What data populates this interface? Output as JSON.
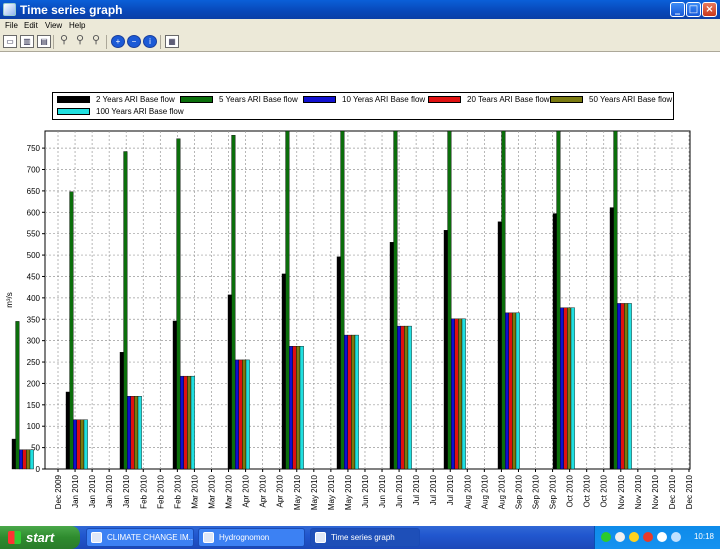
{
  "window": {
    "title": "Time series graph"
  },
  "menu": [
    "File",
    "Edit",
    "View",
    "Help"
  ],
  "toolbar": {
    "buttons": [
      "chart-area-icon",
      "chart-bar-icon",
      "chart-table-icon",
      "zoom-icon",
      "zoom-in-icon",
      "zoom-out-icon",
      "pan-left-icon",
      "pan-right-icon",
      "info-icon",
      "grid-icon"
    ]
  },
  "colors": {
    "s2": "#000000",
    "s5": "#0b6e0b",
    "s10": "#1010d0",
    "s20": "#e01010",
    "s50": "#7a7a10",
    "s100": "#20e0e0",
    "titlebar": "#0a4fc8",
    "taskbar": "#245edb"
  },
  "chart_data": {
    "type": "bar",
    "title": "",
    "xlabel": "",
    "ylabel": "m³/s",
    "ylim": [
      0,
      790
    ],
    "yticks": [
      0,
      50,
      100,
      150,
      200,
      250,
      300,
      350,
      400,
      450,
      500,
      550,
      600,
      650,
      700,
      750
    ],
    "grid": true,
    "legend_position": "top",
    "series": [
      {
        "name": "2 Years ARI Base flow",
        "color": "#000000"
      },
      {
        "name": "5 Years ARI Base flow",
        "color": "#0b6e0b"
      },
      {
        "name": "10 Yeras ARI Base flow",
        "color": "#1010d0"
      },
      {
        "name": "20 Tears ARI Base flow",
        "color": "#e01010"
      },
      {
        "name": "50 Years ARI Base flow",
        "color": "#7a7a10"
      },
      {
        "name": "100 Years ARI Base flow",
        "color": "#20e0e0"
      }
    ],
    "x_tick_labels": [
      "Dec 2009",
      "Jan 2010",
      "Jan 2010",
      "Jan 2010",
      "Jan 2010",
      "Feb 2010",
      "Feb 2010",
      "Feb 2010",
      "Mar 2010",
      "Mar 2010",
      "Mar 2010",
      "Apr 2010",
      "Apr 2010",
      "Apr 2010",
      "May 2010",
      "May 2010",
      "May 2010",
      "May 2010",
      "Jun 2010",
      "Jun 2010",
      "Jun 2010",
      "Jul 2010",
      "Jul 2010",
      "Jul 2010",
      "Aug 2010",
      "Aug 2010",
      "Aug 2010",
      "Sep 2010",
      "Sep 2010",
      "Sep 2010",
      "Oct 2010",
      "Oct 2010",
      "Oct 2010",
      "Nov 2010",
      "Nov 2010",
      "Nov 2010",
      "Dec 2010",
      "Dec 2010"
    ],
    "groups": [
      {
        "x": "Dec 2009",
        "values": [
          70,
          345,
          45,
          45,
          45,
          45
        ]
      },
      {
        "x": "Jan 2010",
        "values": [
          180,
          648,
          115,
          115,
          115,
          115
        ]
      },
      {
        "x": "Feb 2010",
        "values": [
          273,
          742,
          170,
          170,
          170,
          170
        ]
      },
      {
        "x": "Mar 2010",
        "values": [
          346,
          772,
          217,
          217,
          217,
          217
        ]
      },
      {
        "x": "Apr 2010",
        "values": [
          407,
          780,
          255,
          255,
          255,
          255
        ]
      },
      {
        "x": "May 2010",
        "values": [
          456,
          790,
          287,
          287,
          287,
          287
        ]
      },
      {
        "x": "Jun 2010",
        "values": [
          496,
          790,
          313,
          313,
          313,
          313
        ]
      },
      {
        "x": "Jul 2010",
        "values": [
          530,
          790,
          334,
          334,
          334,
          334
        ]
      },
      {
        "x": "Aug 2010",
        "values": [
          558,
          790,
          351,
          351,
          351,
          351
        ]
      },
      {
        "x": "Sep 2010",
        "values": [
          578,
          790,
          365,
          365,
          365,
          365
        ]
      },
      {
        "x": "Oct 2010",
        "values": [
          597,
          790,
          377,
          377,
          377,
          377
        ]
      },
      {
        "x": "Nov 2010",
        "values": [
          611,
          790,
          387,
          387,
          387,
          387
        ]
      }
    ]
  },
  "taskbar": {
    "start": "start",
    "tasks": [
      "CLIMATE CHANGE IM...",
      "Hydrognomon",
      "Time series graph"
    ],
    "clock": "10:18"
  }
}
